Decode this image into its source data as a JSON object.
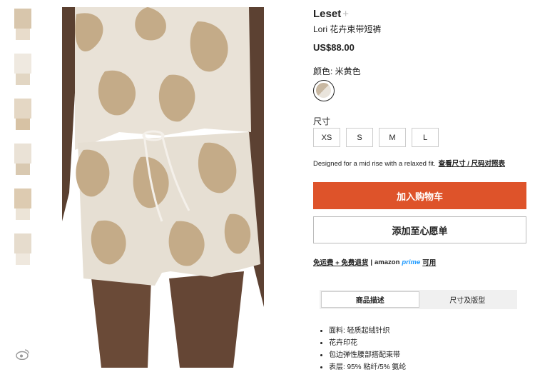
{
  "thumbnails": [
    {
      "label": "thumb-front-top"
    },
    {
      "label": "thumb-front-full"
    },
    {
      "label": "thumb-detail"
    },
    {
      "label": "thumb-side"
    },
    {
      "label": "thumb-fabric"
    },
    {
      "label": "thumb-full-body"
    }
  ],
  "product": {
    "brand": "Leset",
    "brand_plus": "+",
    "name": "Lori 花卉束带短裤",
    "price": "US$88.00",
    "color_label": "颜色: 米黄色",
    "size_label": "尺寸",
    "sizes": [
      "XS",
      "S",
      "M",
      "L"
    ],
    "fit_note": "Designed for a mid rise with a relaxed fit.",
    "size_chart_link": "查看尺寸 / 尺码对照表",
    "add_to_cart": "加入购物车",
    "add_to_wishlist": "添加至心愿单",
    "shipping_link": "免运费 + 免费退货",
    "separator": "|",
    "amazon": "amazon",
    "prime": "prime",
    "available": "可用"
  },
  "tabs": [
    {
      "label": "商品描述",
      "active": true
    },
    {
      "label": "尺寸及版型",
      "active": false
    }
  ],
  "features": [
    "面料: 轻质起绒针织",
    "花卉印花",
    "包边弹性腰部搭配束带",
    "表层: 95% 粘纤/5% 氨纶"
  ],
  "colors": {
    "accent": "#de532a",
    "prime": "#1a98ff",
    "print_tan": "#c8b08e",
    "print_light": "#ece6dc"
  },
  "icons": {
    "wishlist": "heart-icon",
    "social": "weibo-icon"
  }
}
